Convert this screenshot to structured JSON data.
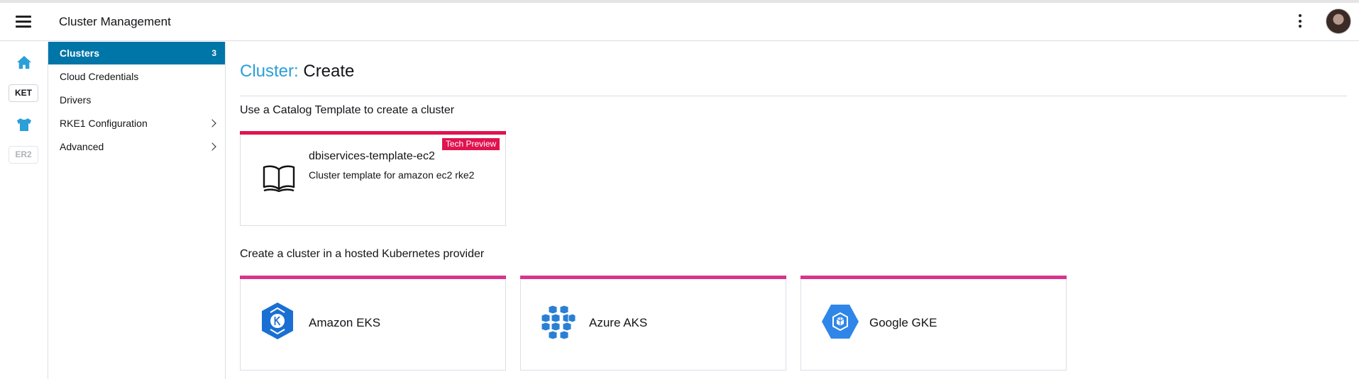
{
  "header": {
    "title": "Cluster Management"
  },
  "rail": {
    "items": [
      {
        "icon": "home-icon"
      },
      {
        "label": "KET"
      },
      {
        "icon": "shirt-icon"
      },
      {
        "label": "ER2"
      }
    ]
  },
  "sidenav": {
    "items": [
      {
        "label": "Clusters",
        "count": "3",
        "active": true
      },
      {
        "label": "Cloud Credentials"
      },
      {
        "label": "Drivers"
      },
      {
        "label": "RKE1 Configuration",
        "expandable": true
      },
      {
        "label": "Advanced",
        "expandable": true
      }
    ]
  },
  "main": {
    "title_prefix": "Cluster:",
    "title": "Create",
    "catalog_heading": "Use a Catalog Template to create a cluster",
    "template": {
      "name": "dbiservices-template-ec2",
      "description": "Cluster template for amazon ec2 rke2",
      "badge": "Tech Preview",
      "icon": "book-icon"
    },
    "hosted_heading": "Create a cluster in a hosted Kubernetes provider",
    "providers": [
      {
        "name": "Amazon EKS",
        "icon": "amazon-eks-icon"
      },
      {
        "name": "Azure AKS",
        "icon": "azure-aks-icon"
      },
      {
        "name": "Google GKE",
        "icon": "google-gke-icon"
      }
    ]
  },
  "colors": {
    "accent": "#0075a8",
    "title_prefix": "#2a9fd8",
    "template_bar": "#e0134f",
    "provider_bar": "#d6358e",
    "badge": "#e0134f"
  }
}
